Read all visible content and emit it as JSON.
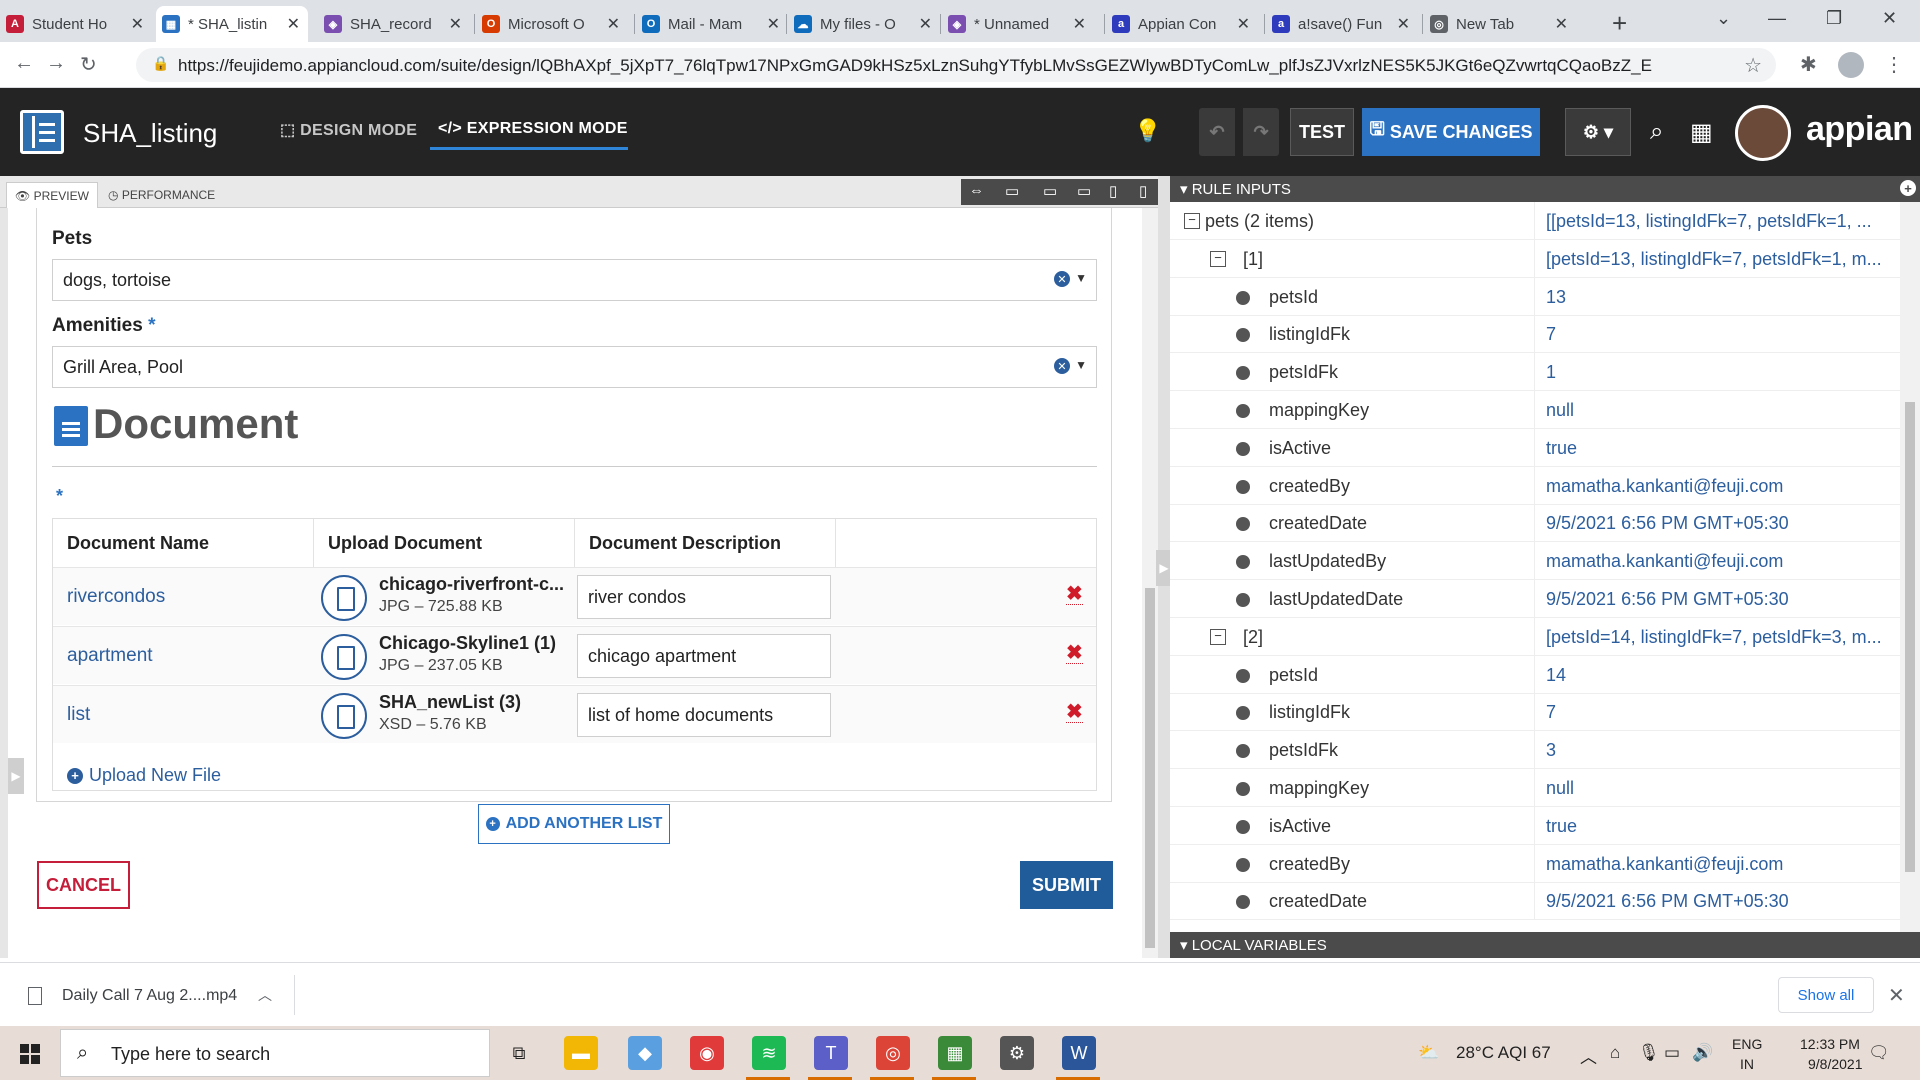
{
  "browser": {
    "tabs": [
      {
        "title": "Student Ho",
        "fav_color": "#c41e3a",
        "fav_glyph": "A"
      },
      {
        "title": "* SHA_listin",
        "fav_color": "#2c72c2",
        "fav_glyph": "▦"
      },
      {
        "title": "SHA_record",
        "fav_color": "#7b4fb0",
        "fav_glyph": "◈"
      },
      {
        "title": "Microsoft O",
        "fav_color": "#d83b01",
        "fav_glyph": "O"
      },
      {
        "title": "Mail - Mam",
        "fav_color": "#0f6cbd",
        "fav_glyph": "O"
      },
      {
        "title": "My files - O",
        "fav_color": "#0f6cbd",
        "fav_glyph": "☁"
      },
      {
        "title": "* Unnamed",
        "fav_color": "#7b4fb0",
        "fav_glyph": "◈"
      },
      {
        "title": "Appian Con",
        "fav_color": "#2f3bbd",
        "fav_glyph": "a"
      },
      {
        "title": "a!save() Fun",
        "fav_color": "#2f3bbd",
        "fav_glyph": "a"
      },
      {
        "title": "New Tab",
        "fav_color": "#5f6368",
        "fav_glyph": "◎"
      }
    ],
    "url": "https://feujidemo.appiancloud.com/suite/design/lQBhAXpf_5jXpT7_76lqTpw17NPxGmGAD9kHSz5xLznSuhgYTfybLMvSsGEZWlywBDTyComLw_plfJsZJVxrlzNES5K5JKGt6eQZvwrtqCQaoBzZ_E",
    "new_tab_glyph": "+",
    "close_glyph": "✕"
  },
  "app": {
    "title": "SHA_listing",
    "design_mode": "DESIGN MODE",
    "expression_mode": "EXPRESSION MODE",
    "test_label": "TEST",
    "save_label": "SAVE CHANGES",
    "brand": "appian"
  },
  "preview_bar": {
    "preview_tab": "PREVIEW",
    "performance_tab": "PERFORMANCE"
  },
  "form": {
    "pets_label": "Pets",
    "pets_value": "dogs, tortoise",
    "amenities_label": "Amenities",
    "amenities_required": "*",
    "amenities_value": "Grill Area, Pool",
    "section_title": "Document",
    "grid_required": "*",
    "columns": [
      "Document Name",
      "Upload Document",
      "Document Description"
    ],
    "rows": [
      {
        "name": "rivercondos",
        "file": "chicago-riverfront-c...",
        "meta": "JPG – 725.88 KB",
        "description": "river condos"
      },
      {
        "name": "apartment",
        "file": "Chicago-Skyline1 (1)",
        "meta": "JPG – 237.05 KB",
        "description": "chicago apartment"
      },
      {
        "name": "list",
        "file": "SHA_newList (3)",
        "meta": "XSD – 5.76 KB",
        "description": "list of home documents"
      }
    ],
    "upload_new": "Upload New File",
    "add_another": "ADD ANOTHER LIST",
    "cancel": "CANCEL",
    "submit": "SUBMIT"
  },
  "rule_inputs": {
    "header": "RULE INPUTS",
    "footer": "LOCAL VARIABLES",
    "rows": [
      {
        "kind": "toggle",
        "indent": 0,
        "name": "pets (2 items)",
        "value": "[[petsId=13, listingIdFk=7, petsIdFk=1, ..."
      },
      {
        "kind": "toggle",
        "indent": 1,
        "name": "[1]",
        "value": "[petsId=13, listingIdFk=7, petsIdFk=1, m..."
      },
      {
        "kind": "dot",
        "indent": 2,
        "name": "petsId",
        "value": "13"
      },
      {
        "kind": "dot",
        "indent": 2,
        "name": "listingIdFk",
        "value": "7"
      },
      {
        "kind": "dot",
        "indent": 2,
        "name": "petsIdFk",
        "value": "1"
      },
      {
        "kind": "dot",
        "indent": 2,
        "name": "mappingKey",
        "value": "null"
      },
      {
        "kind": "dot",
        "indent": 2,
        "name": "isActive",
        "value": "true"
      },
      {
        "kind": "dot",
        "indent": 2,
        "name": "createdBy",
        "value": "mamatha.kankanti@feuji.com"
      },
      {
        "kind": "dot",
        "indent": 2,
        "name": "createdDate",
        "value": "9/5/2021 6:56 PM GMT+05:30"
      },
      {
        "kind": "dot",
        "indent": 2,
        "name": "lastUpdatedBy",
        "value": "mamatha.kankanti@feuji.com"
      },
      {
        "kind": "dot",
        "indent": 2,
        "name": "lastUpdatedDate",
        "value": "9/5/2021 6:56 PM GMT+05:30"
      },
      {
        "kind": "toggle",
        "indent": 1,
        "name": "[2]",
        "value": "[petsId=14, listingIdFk=7, petsIdFk=3, m..."
      },
      {
        "kind": "dot",
        "indent": 2,
        "name": "petsId",
        "value": "14"
      },
      {
        "kind": "dot",
        "indent": 2,
        "name": "listingIdFk",
        "value": "7"
      },
      {
        "kind": "dot",
        "indent": 2,
        "name": "petsIdFk",
        "value": "3"
      },
      {
        "kind": "dot",
        "indent": 2,
        "name": "mappingKey",
        "value": "null"
      },
      {
        "kind": "dot",
        "indent": 2,
        "name": "isActive",
        "value": "true"
      },
      {
        "kind": "dot",
        "indent": 2,
        "name": "createdBy",
        "value": "mamatha.kankanti@feuji.com"
      },
      {
        "kind": "dot",
        "indent": 2,
        "name": "createdDate",
        "value": "9/5/2021 6:56 PM GMT+05:30"
      }
    ]
  },
  "downloads": {
    "file": "Daily Call 7 Aug 2....mp4",
    "show_all": "Show all"
  },
  "taskbar": {
    "search_placeholder": "Type here to search",
    "weather": "28°C  AQI 67",
    "lang_top": "ENG",
    "lang_bottom": "IN",
    "time": "12:33 PM",
    "date": "9/8/2021",
    "apps": [
      {
        "name": "task-view-icon",
        "color": "#e8ddd6",
        "glyph": "⧉"
      },
      {
        "name": "file-explorer-icon",
        "color": "#f2b705",
        "glyph": "▬"
      },
      {
        "name": "onedrive-icon",
        "color": "#5aa0e0",
        "glyph": "◆"
      },
      {
        "name": "record-icon",
        "color": "#e03a3a",
        "glyph": "◉"
      },
      {
        "name": "spotify-icon",
        "color": "#1db954",
        "glyph": "≋"
      },
      {
        "name": "teams-icon",
        "color": "#5b5fc7",
        "glyph": "T"
      },
      {
        "name": "chrome-icon",
        "color": "#db4437",
        "glyph": "◎"
      },
      {
        "name": "sheet-icon",
        "color": "#3a8a3a",
        "glyph": "▦"
      },
      {
        "name": "settings-icon",
        "color": "#555555",
        "glyph": "⚙"
      },
      {
        "name": "word-icon",
        "color": "#2b579a",
        "glyph": "W"
      }
    ]
  }
}
